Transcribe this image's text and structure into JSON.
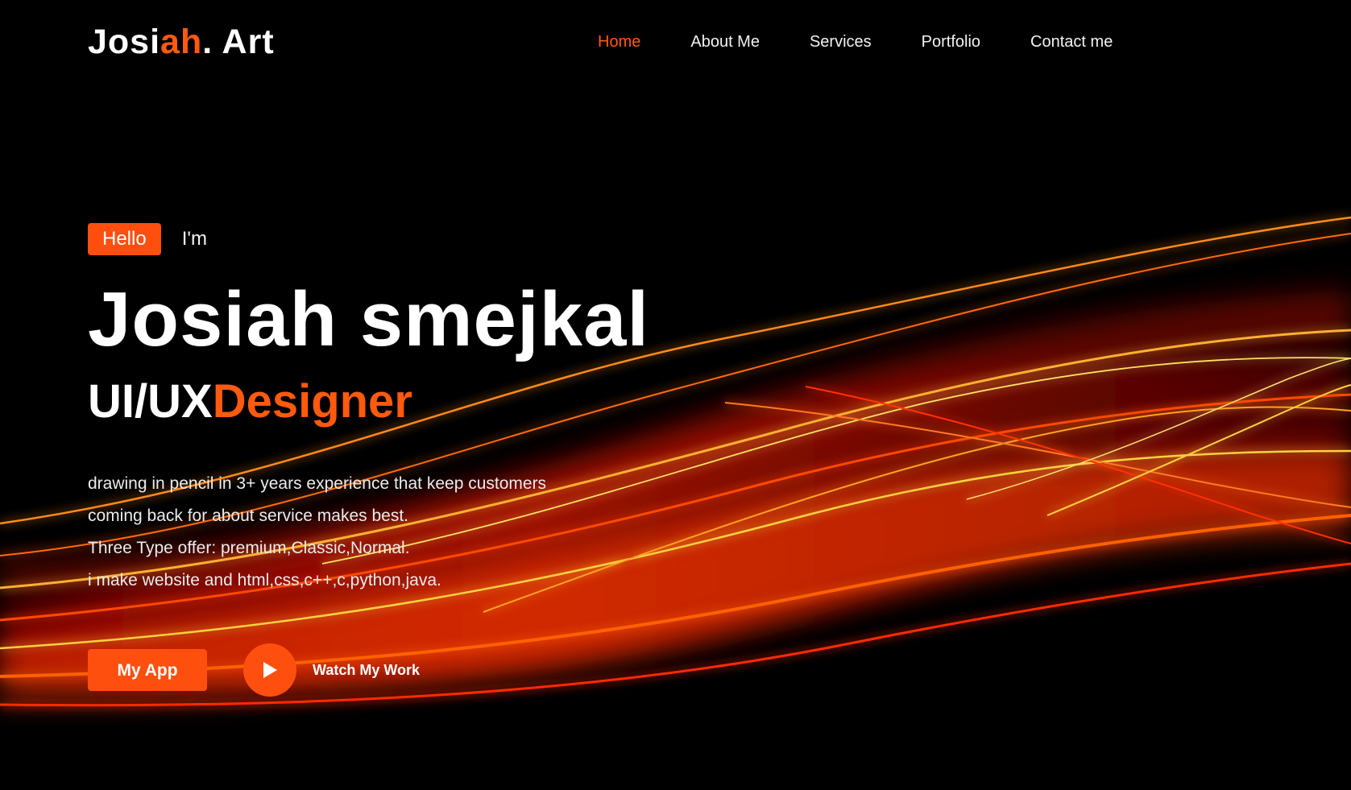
{
  "logo": {
    "part1": "Josi",
    "part2": "ah",
    "part3": ". Art"
  },
  "nav": {
    "items": [
      {
        "label": "Home",
        "active": true
      },
      {
        "label": "About Me",
        "active": false
      },
      {
        "label": "Services",
        "active": false
      },
      {
        "label": "Portfolio",
        "active": false
      },
      {
        "label": "Contact me",
        "active": false
      }
    ]
  },
  "hero": {
    "hello_badge": "Hello",
    "intro": "I'm",
    "name": "Josiah smejkal",
    "role_part1": "UI/UX",
    "role_part2": "Designer",
    "description": [
      "drawing in pencil in 3+ years experience that keep customers",
      "coming back for about service makes best.",
      "Three Type offer: premium,Classic,Normal.",
      "i make website and html,css,c++,c,python,java."
    ],
    "app_button": "My App",
    "play_icon": "play-icon",
    "watch_label": "Watch My Work"
  },
  "colors": {
    "accent": "#ff5a0d",
    "background": "#000000",
    "text": "#ffffff"
  }
}
